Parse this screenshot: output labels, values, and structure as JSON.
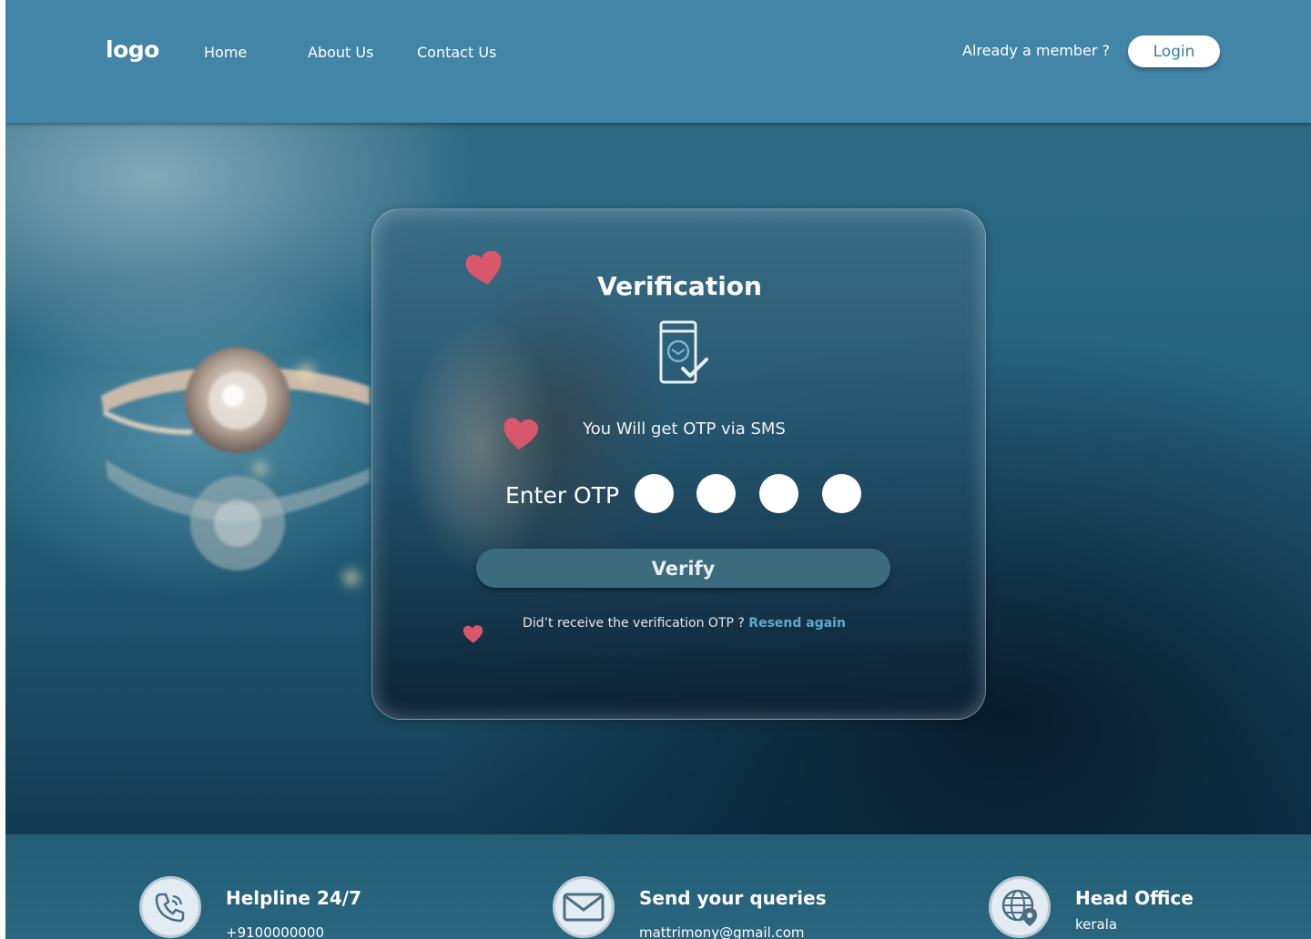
{
  "header": {
    "logo": "logo",
    "nav": [
      "Home",
      "About Us",
      "Contact Us"
    ],
    "member_text": "Already a member ?",
    "login_label": "Login"
  },
  "card": {
    "title": "Verification",
    "otp_note": "You Will get OTP via SMS",
    "otp_label": "Enter OTP",
    "otp_digits": [
      "",
      "",
      "",
      ""
    ],
    "verify_label": "Verify",
    "resend_text": "Did’t receive the verification OTP ?",
    "resend_link": "Resend again"
  },
  "footer": {
    "helpline": {
      "title": "Helpline 24/7",
      "value": "+9100000000",
      "icon": "phone-icon"
    },
    "queries": {
      "title": "Send your queries",
      "value": "mattrimony@gmail.com",
      "icon": "mail-icon"
    },
    "office": {
      "title": "Head Office",
      "value": "kerala",
      "icon": "globe-location-icon"
    }
  },
  "colors": {
    "header_bg": "#4285a6",
    "login_text": "#3c7fa1",
    "verify_bg": "#3c6b7e",
    "resend_link": "#63a8c8",
    "heart": "#d9576a"
  }
}
